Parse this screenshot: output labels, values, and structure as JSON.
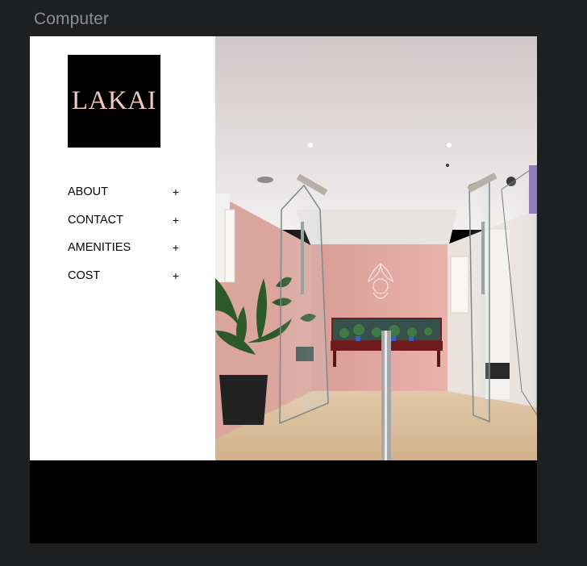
{
  "frame": {
    "label": "Computer"
  },
  "brand": {
    "logo_text": "LAKAI",
    "logo_text_color": "#f1c8c2",
    "logo_bg": "#000000"
  },
  "nav": {
    "items": [
      {
        "label": "ABOUT",
        "expand_glyph": "+"
      },
      {
        "label": "CONTACT",
        "expand_glyph": "+"
      },
      {
        "label": "AMENITIES",
        "expand_glyph": "+"
      },
      {
        "label": "COST",
        "expand_glyph": "+"
      }
    ]
  },
  "hero": {
    "image_subject": "salon-lobby-photo",
    "accent_wall_color": "#e3aaa3",
    "floor_color": "#dcc2a0"
  },
  "footer": {
    "bg": "#000000"
  }
}
